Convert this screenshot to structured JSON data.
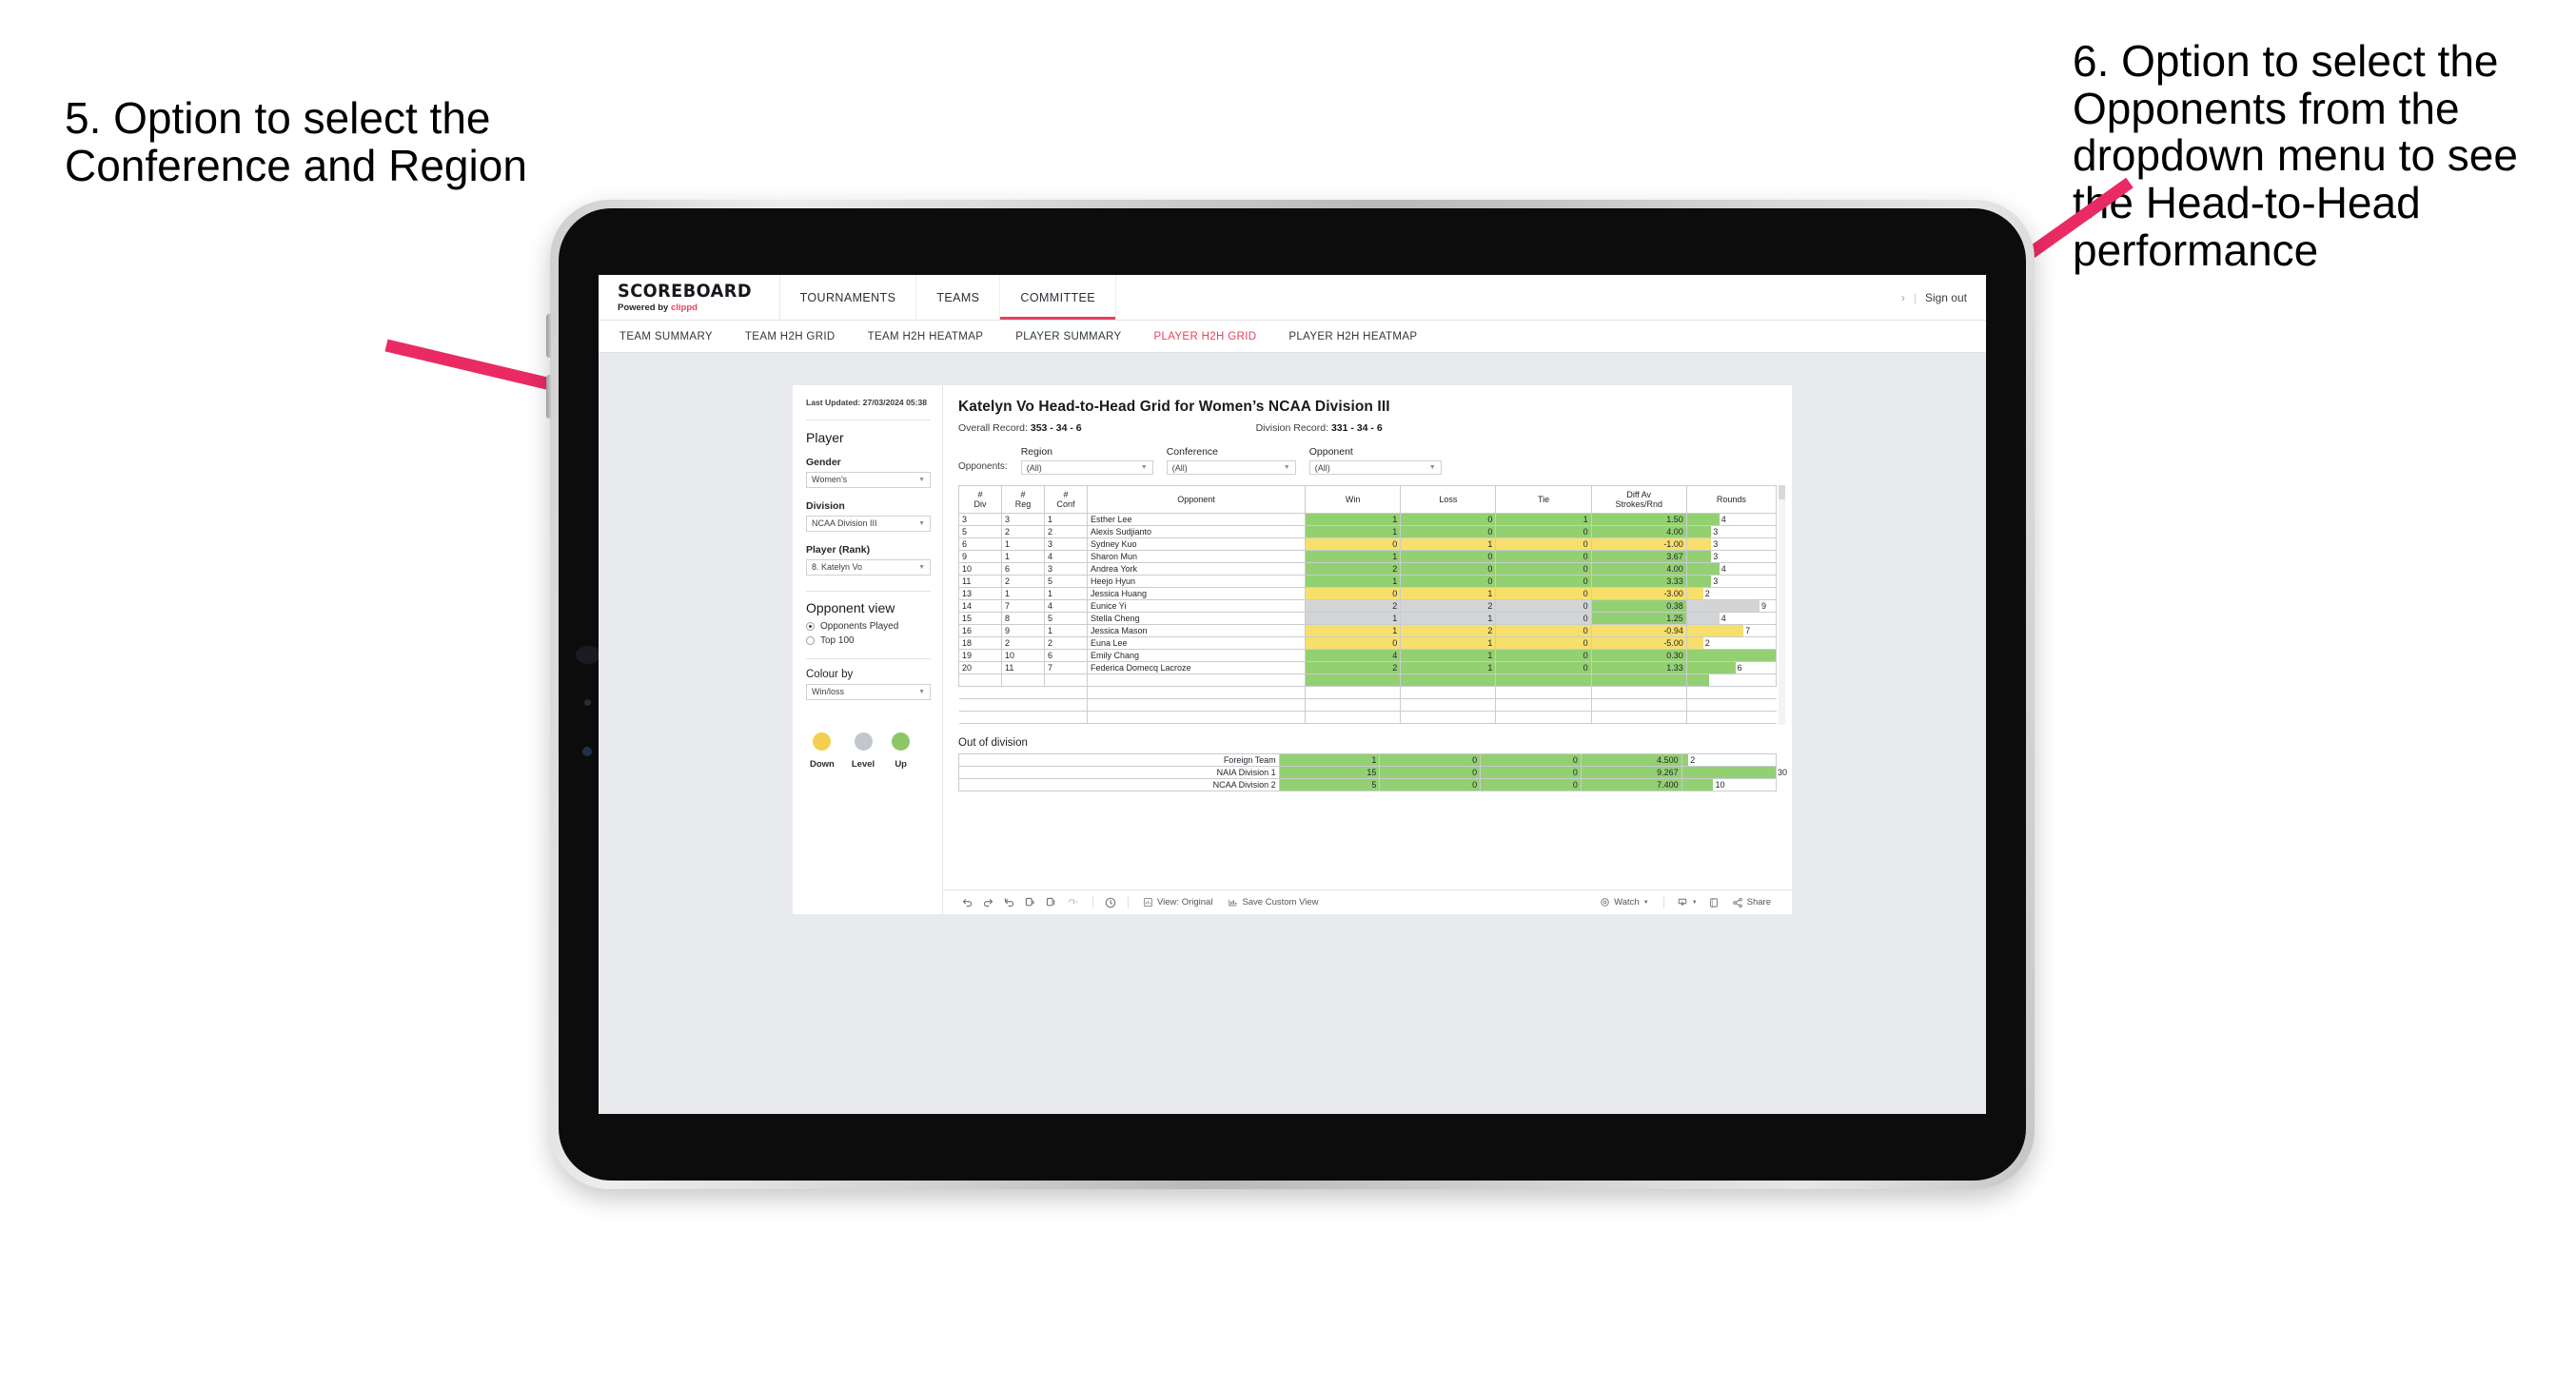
{
  "annotations": {
    "left": "5. Option to select the Conference and Region",
    "right": "6. Option to select the Opponents from the dropdown menu to see the Head-to-Head performance",
    "arrow_color": "#ea2a63"
  },
  "app": {
    "logo": {
      "main": "SCOREBOARD",
      "powered_prefix": "Powered by ",
      "brand": "clippd"
    },
    "topnav": [
      {
        "label": "TOURNAMENTS",
        "active": false
      },
      {
        "label": "TEAMS",
        "active": false
      },
      {
        "label": "COMMITTEE",
        "active": true
      }
    ],
    "topbar_right": {
      "chevron": "›",
      "divider": "|",
      "signout": "Sign out"
    },
    "subnav": [
      {
        "label": "TEAM SUMMARY",
        "active": false
      },
      {
        "label": "TEAM H2H GRID",
        "active": false
      },
      {
        "label": "TEAM H2H HEATMAP",
        "active": false
      },
      {
        "label": "PLAYER SUMMARY",
        "active": false
      },
      {
        "label": "PLAYER H2H GRID",
        "active": true
      },
      {
        "label": "PLAYER H2H HEATMAP",
        "active": false
      }
    ],
    "accent": "#e8415f"
  },
  "sidebar": {
    "last_updated": "Last Updated: 27/03/2024 05:38",
    "player_heading": "Player",
    "gender": {
      "label": "Gender",
      "value": "Women’s"
    },
    "division": {
      "label": "Division",
      "value": "NCAA Division III"
    },
    "player_rank": {
      "label": "Player (Rank)",
      "value": "8. Katelyn Vo"
    },
    "opponent_view": {
      "heading": "Opponent view",
      "options": [
        {
          "label": "Opponents Played",
          "selected": true
        },
        {
          "label": "Top 100",
          "selected": false
        }
      ]
    },
    "colour_by": {
      "label": "Colour by",
      "value": "Win/loss"
    },
    "legend": [
      {
        "caption": "Down",
        "color": "#f2d04e"
      },
      {
        "caption": "Level",
        "color": "#c3c6ca"
      },
      {
        "caption": "Up",
        "color": "#8dc765"
      }
    ]
  },
  "viz": {
    "title": "Katelyn Vo Head-to-Head Grid for Women’s NCAA Division III",
    "overall_record_label": "Overall Record:",
    "overall_record_value": "353 - 34 - 6",
    "division_record_label": "Division Record:",
    "division_record_value": "331 - 34 - 6",
    "opponents_label": "Opponents:",
    "filters": [
      {
        "label": "Region",
        "value": "(All)"
      },
      {
        "label": "Conference",
        "value": "(All)"
      },
      {
        "label": "Opponent",
        "value": "(All)"
      }
    ],
    "columns": [
      "# Div",
      "# Reg",
      "# Conf",
      "Opponent",
      "Win",
      "Loss",
      "Tie",
      "Diff Av Strokes/Rnd",
      "Rounds"
    ],
    "column_lines": {
      "div": [
        "#",
        "Div"
      ],
      "reg": [
        "#",
        "Reg"
      ],
      "conf": [
        "#",
        "Conf"
      ],
      "opponent": "Opponent",
      "win": "Win",
      "loss": "Loss",
      "tie": "Tie",
      "diff": [
        "Diff Av",
        "Strokes/Rnd"
      ],
      "rounds": "Rounds"
    },
    "rounds_max": 11,
    "rows": [
      {
        "div": "3",
        "reg": "3",
        "conf": "1",
        "opponent": "Esther Lee",
        "win": "1",
        "loss": "0",
        "tie": "1",
        "diff": "1.50",
        "rounds": "4",
        "state": "up"
      },
      {
        "div": "5",
        "reg": "2",
        "conf": "2",
        "opponent": "Alexis Sudjianto",
        "win": "1",
        "loss": "0",
        "tie": "0",
        "diff": "4.00",
        "rounds": "3",
        "state": "up"
      },
      {
        "div": "6",
        "reg": "1",
        "conf": "3",
        "opponent": "Sydney Kuo",
        "win": "0",
        "loss": "1",
        "tie": "0",
        "diff": "-1.00",
        "rounds": "3",
        "state": "down"
      },
      {
        "div": "9",
        "reg": "1",
        "conf": "4",
        "opponent": "Sharon Mun",
        "win": "1",
        "loss": "0",
        "tie": "0",
        "diff": "3.67",
        "rounds": "3",
        "state": "up"
      },
      {
        "div": "10",
        "reg": "6",
        "conf": "3",
        "opponent": "Andrea York",
        "win": "2",
        "loss": "0",
        "tie": "0",
        "diff": "4.00",
        "rounds": "4",
        "state": "up"
      },
      {
        "div": "11",
        "reg": "2",
        "conf": "5",
        "opponent": "Heejo Hyun",
        "win": "1",
        "loss": "0",
        "tie": "0",
        "diff": "3.33",
        "rounds": "3",
        "state": "up"
      },
      {
        "div": "13",
        "reg": "1",
        "conf": "1",
        "opponent": "Jessica Huang",
        "win": "0",
        "loss": "1",
        "tie": "0",
        "diff": "-3.00",
        "rounds": "2",
        "state": "down"
      },
      {
        "div": "14",
        "reg": "7",
        "conf": "4",
        "opponent": "Eunice Yi",
        "win": "2",
        "loss": "2",
        "tie": "0",
        "diff": "0.38",
        "rounds": "9",
        "state": "level",
        "diff_state": "up"
      },
      {
        "div": "15",
        "reg": "8",
        "conf": "5",
        "opponent": "Stella Cheng",
        "win": "1",
        "loss": "1",
        "tie": "0",
        "diff": "1.25",
        "rounds": "4",
        "state": "level",
        "diff_state": "up"
      },
      {
        "div": "16",
        "reg": "9",
        "conf": "1",
        "opponent": "Jessica Mason",
        "win": "1",
        "loss": "2",
        "tie": "0",
        "diff": "-0.94",
        "rounds": "7",
        "state": "down"
      },
      {
        "div": "18",
        "reg": "2",
        "conf": "2",
        "opponent": "Euna Lee",
        "win": "0",
        "loss": "1",
        "tie": "0",
        "diff": "-5.00",
        "rounds": "2",
        "state": "down"
      },
      {
        "div": "19",
        "reg": "10",
        "conf": "6",
        "opponent": "Emily Chang",
        "win": "4",
        "loss": "1",
        "tie": "0",
        "diff": "0.30",
        "rounds": "11",
        "state": "up"
      },
      {
        "div": "20",
        "reg": "11",
        "conf": "7",
        "opponent": "Federica Domecq Lacroze",
        "win": "2",
        "loss": "1",
        "tie": "0",
        "diff": "1.33",
        "rounds": "6",
        "state": "up"
      }
    ],
    "out_of_division": {
      "heading": "Out of division",
      "max_rounds": 30,
      "rows": [
        {
          "name": "Foreign Team",
          "win": "1",
          "loss": "0",
          "tie": "0",
          "diff": "4.500",
          "rounds": "2",
          "state": "up"
        },
        {
          "name": "NAIA Division 1",
          "win": "15",
          "loss": "0",
          "tie": "0",
          "diff": "9.267",
          "rounds": "30",
          "state": "up"
        },
        {
          "name": "NCAA Division 2",
          "win": "5",
          "loss": "0",
          "tie": "0",
          "diff": "7.400",
          "rounds": "10",
          "state": "up"
        }
      ]
    },
    "colors": {
      "up": "#93d072",
      "down": "#f7df6b",
      "level": "#d3d4d6"
    },
    "toolbar": {
      "icons": [
        "undo-icon",
        "redo-icon",
        "revert-icon",
        "refresh-icon",
        "pause-icon",
        "reset-icon"
      ],
      "view_label": "View: Original",
      "save_label": "Save Custom View",
      "watch_label": "Watch",
      "share_label": "Share"
    }
  }
}
